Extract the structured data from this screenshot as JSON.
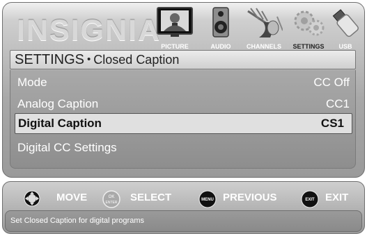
{
  "brand": {
    "logo": "INSIGNIA",
    "trademark": "TM"
  },
  "tabs": [
    {
      "label": "PICTURE",
      "active": false
    },
    {
      "label": "AUDIO",
      "active": false
    },
    {
      "label": "CHANNELS",
      "active": false
    },
    {
      "label": "SETTINGS",
      "active": true
    },
    {
      "label": "USB",
      "active": false
    }
  ],
  "header": {
    "title": "SETTINGS",
    "bullet": "•",
    "subtitle": "Closed Caption"
  },
  "menu": {
    "items": [
      {
        "label": "Mode",
        "value": "CC Off",
        "selected": false
      },
      {
        "label": "Analog Caption",
        "value": "CC1",
        "selected": false
      },
      {
        "label": "Digital Caption",
        "value": "CS1",
        "selected": true
      },
      {
        "label": "Digital CC Settings",
        "value": "",
        "selected": false
      }
    ]
  },
  "controls": {
    "move": {
      "label": "MOVE",
      "icon": "dpad-icon"
    },
    "select": {
      "label": "SELECT",
      "icon_top": "OK",
      "icon_bottom": "ENTER"
    },
    "previous": {
      "label": "PREVIOUS",
      "icon": "MENU"
    },
    "exit": {
      "label": "EXIT",
      "icon": "EXIT"
    }
  },
  "status": {
    "help_text": "Set Closed Caption for digital programs"
  }
}
